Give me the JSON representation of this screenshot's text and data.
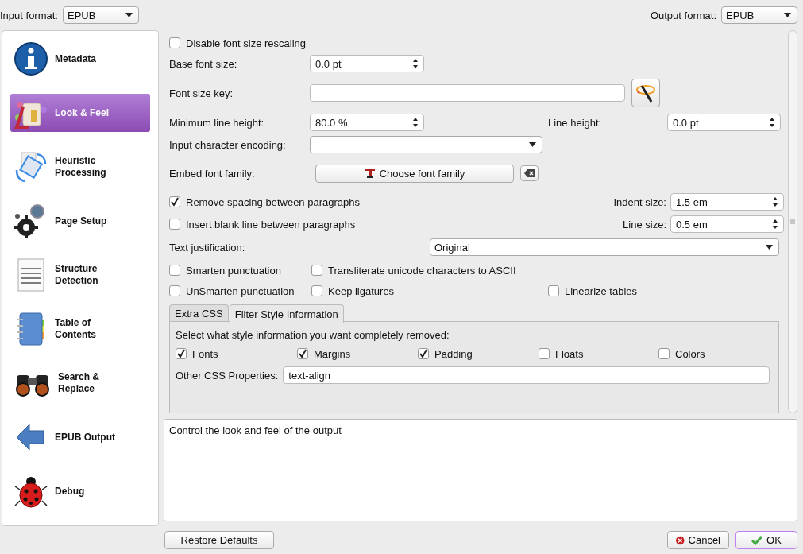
{
  "input_format": {
    "label": "Input format:",
    "value": "EPUB"
  },
  "output_format": {
    "label": "Output format:",
    "value": "EPUB"
  },
  "sidebar": {
    "items": [
      {
        "label": "Metadata",
        "kind": "info",
        "selected": false
      },
      {
        "label": "Look & Feel",
        "kind": "paint",
        "selected": true
      },
      {
        "label": "Heuristic Processing",
        "kind": "rotate",
        "selected": false
      },
      {
        "label": "Page Setup",
        "kind": "gears",
        "selected": false
      },
      {
        "label": "Structure Detection",
        "kind": "document",
        "selected": false
      },
      {
        "label": "Table of Contents",
        "kind": "notebook",
        "selected": false
      },
      {
        "label": "Search & Replace",
        "kind": "binoculars",
        "selected": false
      },
      {
        "label": "EPUB Output",
        "kind": "arrow",
        "selected": false
      },
      {
        "label": "Debug",
        "kind": "ladybug",
        "selected": false
      }
    ]
  },
  "disable_font_size_rescaling": {
    "label": "Disable font size rescaling",
    "checked": false
  },
  "base_font_size": {
    "label": "Base font size:",
    "value": "0.0 pt"
  },
  "font_size_key": {
    "label": "Font size key:"
  },
  "minimum_line_height": {
    "label": "Minimum line height:",
    "value": "80.0 %"
  },
  "line_height": {
    "label": "Line height:",
    "value": "0.0 pt"
  },
  "input_character_encoding": {
    "label": "Input character encoding:"
  },
  "embed_font_family": {
    "label": "Embed font family:",
    "button": "Choose font family"
  },
  "remove_spacing": {
    "label": "Remove spacing between paragraphs",
    "checked": true
  },
  "indent_size": {
    "label": "Indent size:",
    "value": "1.5 em"
  },
  "insert_blank_line": {
    "label": "Insert blank line between paragraphs",
    "checked": false
  },
  "line_size": {
    "label": "Line size:",
    "value": "0.5 em"
  },
  "text_justification": {
    "label": "Text justification:",
    "value": "Original"
  },
  "option_rows": [
    [
      {
        "label": "Smarten punctuation",
        "checked": false
      },
      {
        "label": "Transliterate unicode characters to ASCII",
        "checked": false
      }
    ],
    [
      {
        "label": "UnSmarten punctuation",
        "checked": false
      },
      {
        "label": "Keep ligatures",
        "checked": false
      },
      {
        "label": "Linearize tables",
        "checked": false
      }
    ]
  ],
  "tabs": [
    {
      "label": "Extra CSS",
      "selected": false
    },
    {
      "label": "Filter Style Information",
      "selected": true
    }
  ],
  "filter_style": {
    "prompt": "Select what style information you want completely removed:",
    "properties": [
      {
        "label": "Fonts",
        "checked": true
      },
      {
        "label": "Margins",
        "checked": true
      },
      {
        "label": "Padding",
        "checked": true
      },
      {
        "label": "Floats",
        "checked": false
      },
      {
        "label": "Colors",
        "checked": false
      }
    ],
    "other_label": "Other CSS Properties:",
    "other_value": "text-align"
  },
  "description": "Control the look and feel of the output",
  "buttons": {
    "restore_defaults": "Restore Defaults",
    "cancel": "Cancel",
    "ok": "OK"
  }
}
